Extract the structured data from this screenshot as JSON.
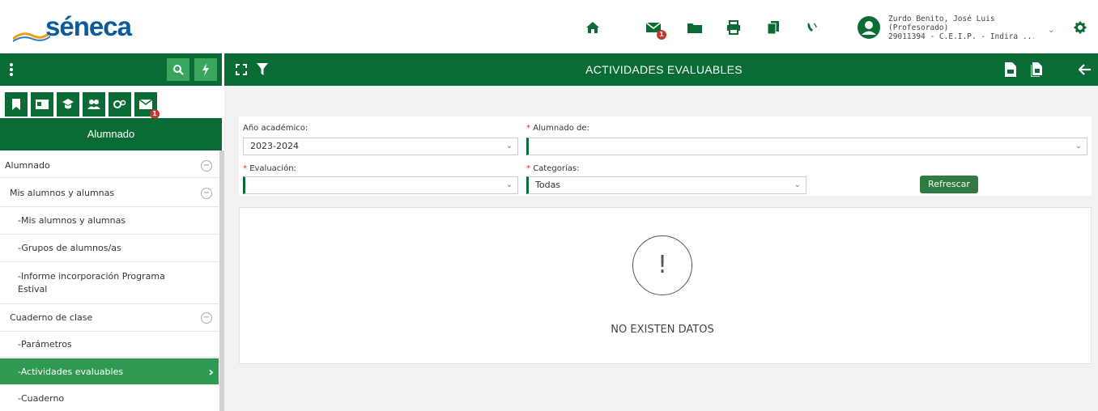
{
  "app": {
    "logo_text": "séneca"
  },
  "header": {
    "user_line1": "Zurdo Benito, José Luis",
    "user_line2": "(Profesorado)",
    "user_line3": "29011394 - C.E.I.P. - Indira ...",
    "notification_badge": "1",
    "icons": [
      "home-icon",
      "mail-icon",
      "folder-icon",
      "print-icon",
      "documents-icon",
      "phone-icon",
      "user-avatar-icon",
      "gear-icon"
    ]
  },
  "toolbar": {
    "title": "ACTIVIDADES EVALUABLES"
  },
  "sidebar": {
    "tabs_badge": "1",
    "section_title": "Alumnado",
    "items": [
      {
        "label": "Alumnado"
      },
      {
        "label": "Mis alumnos y alumnas"
      },
      {
        "label": "-Mis alumnos y alumnas"
      },
      {
        "label": "-Grupos de alumnos/as"
      },
      {
        "label": "-Informe incorporación Programa Estival"
      },
      {
        "label": "Cuaderno de clase"
      },
      {
        "label": "-Parámetros"
      },
      {
        "label": "-Actividades evaluables"
      },
      {
        "label": "-Cuaderno"
      }
    ]
  },
  "filters": {
    "anio_label": "Año académico:",
    "anio_value": "2023-2024",
    "alumnado_label": "Alumnado de:",
    "alumnado_value": "",
    "evaluacion_label": "Evaluación:",
    "evaluacion_value": "",
    "categorias_label": "Categorías:",
    "categorias_value": "Todas",
    "refresh_label": "Refrescar",
    "required_mark": "*"
  },
  "empty_state": {
    "icon_text": "!",
    "message": "NO EXISTEN DATOS"
  },
  "colors": {
    "brand_green": "#0b6b34",
    "active_green": "#2f9a52",
    "logo_blue": "#0a5a9c",
    "badge_red": "#c0392b"
  }
}
